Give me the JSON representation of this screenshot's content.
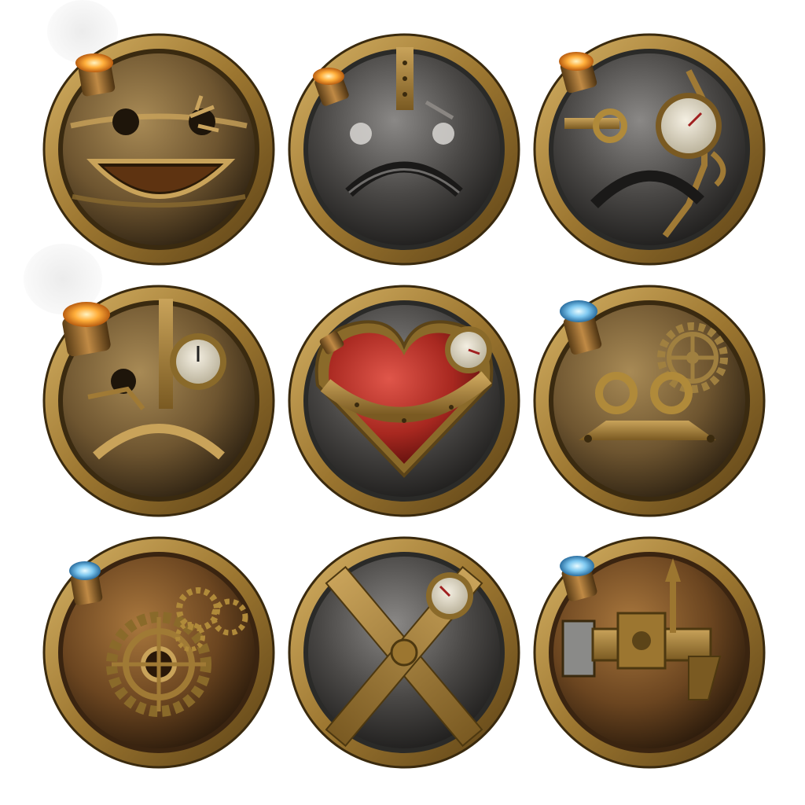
{
  "colors": {
    "background": "#ffffff",
    "brass_rim": "#b08a3a",
    "brass_dark": "#5c4418",
    "steel_face": "#3b3a38",
    "copper_face": "#7a5524",
    "heart_red": "#b02a22",
    "flame_orange": "#ffae3a",
    "flame_blue": "#7ec8f0"
  },
  "icons": [
    {
      "row": 1,
      "col": 1,
      "name": "happy-face-icon",
      "face": "bronze",
      "pipe_flame": "orange",
      "steam": true
    },
    {
      "row": 1,
      "col": 2,
      "name": "sad-face-icon",
      "face": "steel",
      "pipe_flame": "orange",
      "steam": false
    },
    {
      "row": 1,
      "col": 3,
      "name": "frowning-gauge-face-icon",
      "face": "steel",
      "pipe_flame": "orange",
      "steam": false
    },
    {
      "row": 2,
      "col": 1,
      "name": "sad-gauge-face-icon",
      "face": "bronze",
      "pipe_flame": "orange",
      "steam": true
    },
    {
      "row": 2,
      "col": 2,
      "name": "heart-gauge-icon",
      "face": "steel",
      "pipe_flame": "none",
      "steam": true
    },
    {
      "row": 2,
      "col": 3,
      "name": "neutral-gear-face-icon",
      "face": "bronze",
      "pipe_flame": "blue",
      "steam": false
    },
    {
      "row": 3,
      "col": 1,
      "name": "gears-icon",
      "face": "copper",
      "pipe_flame": "blue",
      "steam": false
    },
    {
      "row": 3,
      "col": 2,
      "name": "cross-x-gauge-icon",
      "face": "steel",
      "pipe_flame": "none",
      "steam": true
    },
    {
      "row": 3,
      "col": 3,
      "name": "machine-gun-icon",
      "face": "copper",
      "pipe_flame": "blue",
      "steam": false
    }
  ]
}
